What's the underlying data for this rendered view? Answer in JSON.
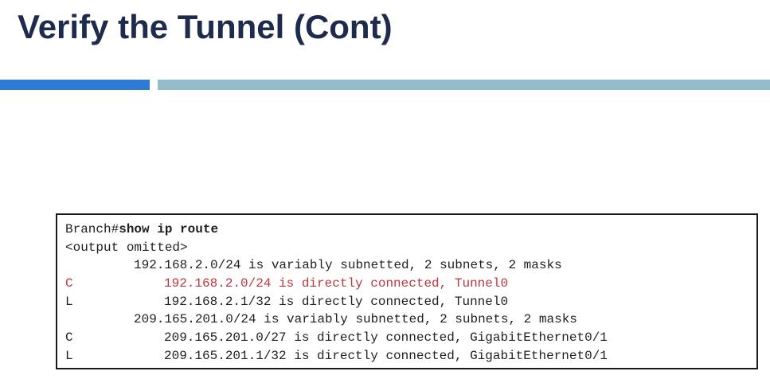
{
  "slide": {
    "title": "Verify the Tunnel (Cont)"
  },
  "colors": {
    "title": "#1f2b4d",
    "accent_bar_left": "#2e7bd6",
    "accent_bar_right": "#93bdcc",
    "highlight": "#c0363b",
    "terminal_text": "#1f1f1f"
  },
  "terminal": {
    "prompt": "Branch#",
    "command": "show ip route",
    "omitted": "<output omitted>",
    "routes": [
      {
        "code": "",
        "text": "192.168.2.0/24 is variably subnetted, 2 subnets, 2 masks",
        "level": 1,
        "highlight": false
      },
      {
        "code": "C",
        "text": "192.168.2.0/24 is directly connected, Tunnel0",
        "level": 2,
        "highlight": true
      },
      {
        "code": "L",
        "text": "192.168.2.1/32 is directly connected, Tunnel0",
        "level": 2,
        "highlight": false
      },
      {
        "code": "",
        "text": "209.165.201.0/24 is variably subnetted, 2 subnets, 2 masks",
        "level": 1,
        "highlight": false
      },
      {
        "code": "C",
        "text": "209.165.201.0/27 is directly connected, GigabitEthernet0/1",
        "level": 2,
        "highlight": false
      },
      {
        "code": "L",
        "text": "209.165.201.1/32 is directly connected, GigabitEthernet0/1",
        "level": 2,
        "highlight": false
      }
    ]
  }
}
